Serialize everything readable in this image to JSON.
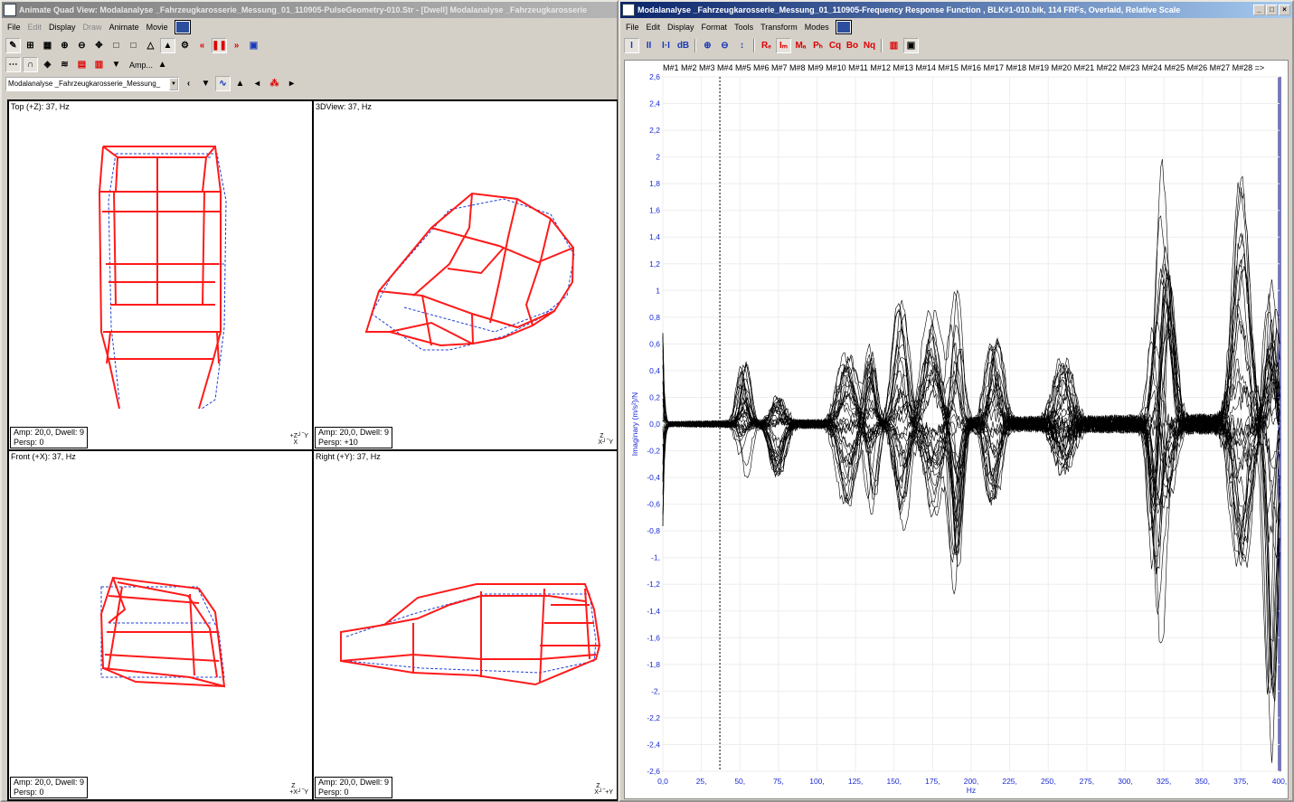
{
  "left_window": {
    "title": "Animate Quad View: Modalanalyse _Fahrzeugkarosserie_Messung_01_110905-PulseGeometry-010.Str - [Dwell] Modalanalyse _Fahrzeugkarosserie",
    "menu": [
      "File",
      "Edit",
      "Display",
      "Draw",
      "Animate",
      "Movie"
    ],
    "toolbar1": [
      "✎",
      "⊞",
      "▦",
      "⊕",
      "⊖",
      "✥",
      "□",
      "□",
      "△",
      "▲",
      "⚙",
      "«",
      "❚❚",
      "»",
      "▣"
    ],
    "toolbar2_amp_label": "Amp...",
    "shape_combo": "Modalanalyse _Fahrzeugkarosserie_Messung_",
    "panes": [
      {
        "label": "Top (+Z): 37, Hz",
        "info1": "Amp: 20,0,  Dwell: 9",
        "info2": "Persp: 0"
      },
      {
        "label": "3DView: 37, Hz",
        "info1": "Amp: 20,0,  Dwell: 9",
        "info2": "Persp: +10"
      },
      {
        "label": "Front (+X): 37, Hz",
        "info1": "Amp: 20,0,  Dwell: 9",
        "info2": "Persp: 0"
      },
      {
        "label": "Right (+Y): 37, Hz",
        "info1": "Amp: 20,0,  Dwell: 9",
        "info2": "Persp: 0"
      }
    ],
    "colors": {
      "model": "#ff1a1a",
      "undeformed": "#1f3fd6"
    }
  },
  "right_window": {
    "title": "Modalanalyse _Fahrzeugkarosserie_Messung_01_110905-Frequency Response Function , BLK#1-010.blk, 114 FRFs, Overlaid, Relative Scale",
    "menu": [
      "File",
      "Edit",
      "Display",
      "Format",
      "Tools",
      "Transform",
      "Modes"
    ],
    "toolbar": [
      "I",
      "II",
      "I·I",
      "dB",
      "⊕",
      "⊖",
      "↕",
      "Rₑ",
      "Iₘ",
      "Mₐ",
      "Pₕ",
      "Cq",
      "Bo",
      "Nq",
      "▥",
      "▣"
    ],
    "mode_markers": "M#1 M#2 M#3 M#4 M#5 M#6 M#7 M#8 M#9 M#10 M#11 M#12 M#13 M#14 M#15 M#16 M#17 M#18 M#19 M#20 M#21 M#22 M#23 M#24 M#25 M#26 M#27 M#28 =>"
  },
  "chart_data": {
    "type": "line",
    "title": "",
    "xlabel": "Hz",
    "ylabel": "Imaginary (m/s²)/N",
    "xlim": [
      0,
      400
    ],
    "ylim": [
      -2.6,
      2.6
    ],
    "x_ticks": [
      "0,0",
      "25,",
      "50,",
      "75,",
      "100,",
      "125,",
      "150,",
      "175,",
      "200,",
      "225,",
      "250,",
      "275,",
      "300,",
      "325,",
      "350,",
      "375,",
      "400,"
    ],
    "y_ticks": [
      "2,6",
      "2,4",
      "2,2",
      "2",
      "1,8",
      "1,6",
      "1,4",
      "1,2",
      "1",
      "0,8",
      "0,6",
      "0,4",
      "0,2",
      "0,0",
      "-0,2",
      "-0,4",
      "-0,6",
      "-0,8",
      "-1,",
      "-1,2",
      "-1,4",
      "-1,6",
      "-1,8",
      "-2,",
      "-2,2",
      "-2,4",
      "-2,6"
    ],
    "cursor_hz": 37,
    "series_count": 114,
    "series_description": "114 overlaid FRFs (black)",
    "peaks": [
      {
        "hz": 52,
        "max": 0.45,
        "min": -0.55
      },
      {
        "hz": 75,
        "max": 0.2,
        "min": -0.4
      },
      {
        "hz": 120,
        "max": 0.5,
        "min": -0.6
      },
      {
        "hz": 135,
        "max": 0.6,
        "min": -0.7
      },
      {
        "hz": 155,
        "max": 1.0,
        "min": -0.8
      },
      {
        "hz": 175,
        "max": 0.85,
        "min": -0.7
      },
      {
        "hz": 190,
        "max": 1.1,
        "min": -1.35
      },
      {
        "hz": 215,
        "max": 0.7,
        "min": -0.6
      },
      {
        "hz": 260,
        "max": 0.5,
        "min": -0.4
      },
      {
        "hz": 320,
        "max": 0.75,
        "min": -1.25
      },
      {
        "hz": 327,
        "max": 1.75,
        "min": -0.6
      },
      {
        "hz": 375,
        "max": 1.9,
        "min": -1.1
      },
      {
        "hz": 395,
        "max": 1.05,
        "min": -2.6
      }
    ]
  }
}
